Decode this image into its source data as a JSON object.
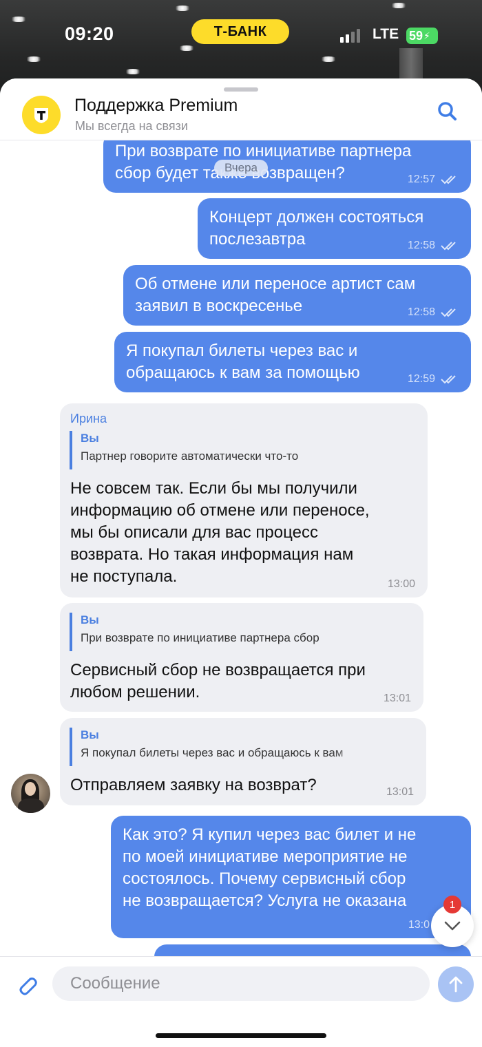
{
  "status_bar": {
    "time": "09:20",
    "carrier_badge": "Т-БАНК",
    "network": "LTE",
    "battery_level": "59"
  },
  "header": {
    "title": "Поддержка Premium",
    "subtitle": "Мы всегда на связи",
    "logo_letter": "Т"
  },
  "date_separator": "Вчера",
  "messages": [
    {
      "direction": "out",
      "text_lines": [
        "При возврате по инициативе партнера",
        "сбор будет также возвращен?"
      ],
      "time": "12:57",
      "read": true
    },
    {
      "direction": "out",
      "text_lines": [
        "Концерт должен состояться",
        "послезавтра"
      ],
      "time": "12:58",
      "read": true
    },
    {
      "direction": "out",
      "text_lines": [
        "Об отмене или переносе артист сам",
        "заявил в воскресенье"
      ],
      "time": "12:58",
      "read": true
    },
    {
      "direction": "out",
      "text_lines": [
        "Я покупал билеты через вас и",
        "обращаюсь к вам за помощью"
      ],
      "time": "12:59",
      "read": true
    },
    {
      "direction": "in",
      "sender": "Ирина",
      "reply_to": {
        "author": "Вы",
        "text": "Партнер говорите автоматически что-то"
      },
      "text_lines": [
        "Не совсем так. Если бы мы получили",
        "информацию об отмене или переносе,",
        "мы бы описали для вас процесс",
        "возврата. Но такая информация нам",
        "не поступала."
      ],
      "time": "13:00"
    },
    {
      "direction": "in",
      "reply_to": {
        "author": "Вы",
        "text": "При возврате по инициативе партнера  сбор"
      },
      "text_lines": [
        "Сервисный сбор не возвращается при",
        "любом решении."
      ],
      "time": "13:01"
    },
    {
      "direction": "in",
      "reply_to": {
        "author": "Вы",
        "text": "Я покупал билеты через вас и обращаюсь к вам"
      },
      "text_lines": [
        "Отправляем заявку на возврат?"
      ],
      "time": "13:01"
    },
    {
      "direction": "out",
      "text_lines": [
        "Как это? Я купил через вас билет и не",
        "по моей инициативе мероприятие не",
        "состоялось. Почему сервисный сбор",
        "не возвращается? Услуга не оказана"
      ],
      "time": "13:0",
      "read": false
    }
  ],
  "scroll_badge": "1",
  "composer": {
    "placeholder": "Сообщение"
  },
  "colors": {
    "outgoing_bubble": "#5587ea",
    "incoming_bubble": "#eeeff3",
    "accent": "#4a7fe0",
    "brand_yellow": "#fddc2a"
  },
  "icons": {
    "search": "search-icon",
    "attach": "paperclip-icon",
    "send": "arrow-up-icon",
    "scroll": "chevron-down-icon",
    "read": "double-check-icon"
  }
}
